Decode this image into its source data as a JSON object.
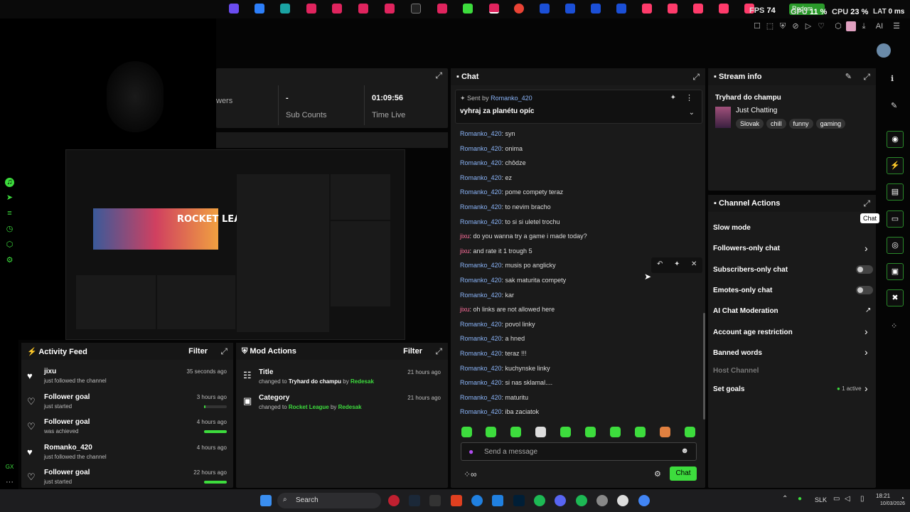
{
  "perf": {
    "fps_label": "FPS",
    "fps": "74",
    "gpu_label": "GPU",
    "gpu": "11 %",
    "cpu_label": "CPU",
    "cpu": "23 %",
    "lat_label": "LAT",
    "lat": "0 ms"
  },
  "stats": {
    "subcount_value": "-",
    "subcount_label": "Sub Counts",
    "timelive_value": "01:09:56",
    "timelive_label": "Time Live",
    "viewers_label": "wers"
  },
  "chat": {
    "title": "Chat",
    "pinned_by_prefix": "Sent by",
    "pinned_by": "Romanko_420",
    "pinned_msg": "vyhraj za planétu opíc",
    "messages": [
      {
        "user": "Romanko_420",
        "text": ": syn",
        "alt": false
      },
      {
        "user": "Romanko_420",
        "text": ": onima",
        "alt": false
      },
      {
        "user": "Romanko_420",
        "text": ": chôdze",
        "alt": false
      },
      {
        "user": "Romanko_420",
        "text": ": ez",
        "alt": false
      },
      {
        "user": "Romanko_420",
        "text": ": pome compety teraz",
        "alt": false
      },
      {
        "user": "Romanko_420",
        "text": ": to nevim bracho",
        "alt": false
      },
      {
        "user": "Romanko_420",
        "text": ": to si si uletel trochu",
        "alt": false
      },
      {
        "user": "jixu",
        "text": ": do you wanna try a game i made today?",
        "alt": true
      },
      {
        "user": "jixu",
        "text": ": and rate it 1 trough 5",
        "alt": true
      },
      {
        "user": "Romanko_420",
        "text": ": musis po anglicky",
        "alt": false
      },
      {
        "user": "Romanko_420",
        "text": ": sak maturita compety",
        "alt": false
      },
      {
        "user": "Romanko_420",
        "text": ": kar",
        "alt": false
      },
      {
        "user": "jixu",
        "text": ": oh links are not allowed here",
        "alt": true
      },
      {
        "user": "Romanko_420",
        "text": ": povol linky",
        "alt": false
      },
      {
        "user": "Romanko_420",
        "text": ": a hned",
        "alt": false
      },
      {
        "user": "Romanko_420",
        "text": ": teraz !!!",
        "alt": false
      },
      {
        "user": "Romanko_420",
        "text": ": kuchynske linky",
        "alt": false
      },
      {
        "user": "Romanko_420",
        "text": ": si nas sklamal....",
        "alt": false
      },
      {
        "user": "Romanko_420",
        "text": ": maturitu",
        "alt": false
      },
      {
        "user": "Romanko_420",
        "text": ": iba zaciatok",
        "alt": false
      }
    ],
    "input_placeholder": "Send a message",
    "send_label": "Chat",
    "tooltip": "Chat"
  },
  "stream_info": {
    "title": "Stream info",
    "stream_title": "Tryhard do champu",
    "category": "Just Chatting",
    "tags": [
      "Slovak",
      "chill",
      "funny",
      "gaming"
    ]
  },
  "channel_actions": {
    "title": "Channel Actions",
    "items": [
      "Slow mode",
      "Followers-only chat",
      "Subscribers-only chat",
      "Emotes-only chat",
      "AI Chat Moderation",
      "Account age restriction",
      "Banned words",
      "Host Channel",
      "Set goals"
    ],
    "set_goals_status": "1 active"
  },
  "activity_feed": {
    "title": "Activity Feed",
    "filter": "Filter",
    "items": [
      {
        "title": "jixu",
        "sub": "just followed the channel",
        "ago": "35 seconds ago",
        "progress": null
      },
      {
        "title": "Follower goal",
        "sub": "just started",
        "ago": "3 hours ago",
        "progress": 0.05
      },
      {
        "title": "Follower goal",
        "sub": "was achieved",
        "ago": "4 hours ago",
        "progress": 1
      },
      {
        "title": "Romanko_420",
        "sub": "just followed the channel",
        "ago": "4 hours ago",
        "progress": null
      },
      {
        "title": "Follower goal",
        "sub": "just started",
        "ago": "22 hours ago",
        "progress": 1
      }
    ]
  },
  "mod_actions": {
    "title": "Mod Actions",
    "filter": "Filter",
    "items": [
      {
        "title": "Title",
        "pre": "changed to",
        "value": "Tryhard do champu",
        "by": "by",
        "user": "Redesak",
        "ago": "21 hours ago"
      },
      {
        "title": "Category",
        "pre": "changed to",
        "value": "Rocket League",
        "by": "by",
        "user": "Redesak",
        "ago": "21 hours ago"
      }
    ]
  },
  "taskbar": {
    "search": "Search",
    "lang": "SLK",
    "time": "18:21",
    "date": "10/03/2026"
  },
  "preview": {
    "game": "ROCKET LEAGUE"
  },
  "browser": {
    "redeem": "Redem",
    "ai": "AI"
  }
}
